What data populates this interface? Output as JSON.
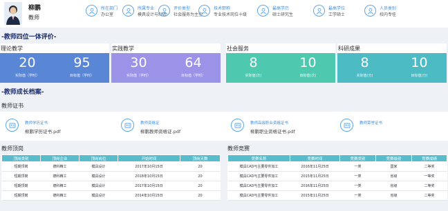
{
  "profile": {
    "name": "柳鹏",
    "role": "教师",
    "fields": [
      {
        "label": "所在部门",
        "value": "办公室"
      },
      {
        "label": "所属专业",
        "value": "模具设计与制造"
      },
      {
        "label": "评价类型",
        "value": "社会服务为主型"
      },
      {
        "label": "技术职称",
        "value": "专业技术岗位十级"
      },
      {
        "label": "最高学历",
        "value": "硕士研究生"
      },
      {
        "label": "最高学位",
        "value": "工学硕士"
      },
      {
        "label": "人员类别",
        "value": "校内专任"
      }
    ]
  },
  "evaluation": {
    "title": "-教师四位一体评价-",
    "cards": [
      {
        "title": "理论教学",
        "color": "#5a86d6",
        "actual": "20",
        "actual_label": "实际值（学时）",
        "target": "95",
        "target_label": "目标值（学时）"
      },
      {
        "title": "实践教学",
        "color": "#9b93e8",
        "actual": "30",
        "actual_label": "实际值（学时）",
        "target": "64",
        "target_label": "目标值（学时）"
      },
      {
        "title": "社会服务",
        "color": "#4ec9b0",
        "actual": "8",
        "actual_label": "实际值(次)",
        "target": "10",
        "target_label": "目标值(次)"
      },
      {
        "title": "科研成果",
        "color": "#4dbbc4",
        "actual": "8",
        "actual_label": "实际值(分)",
        "target": "10",
        "target_label": "目标值(分)"
      }
    ]
  },
  "growth": {
    "title": "-教师成长档案-",
    "certificates_title": "教师证书",
    "certificates": [
      {
        "label": "教师学历证书",
        "file": "柳鹏学历证书.pdf"
      },
      {
        "label": "教师资格证",
        "file": "柳鹏教师资格证.pdf"
      },
      {
        "label": "教师高级职业资格证书",
        "file": "柳鹏职业资格证书.pdf"
      },
      {
        "label": "教师荣誉证书",
        "file": ""
      }
    ]
  },
  "posts": {
    "title": "教师顶岗",
    "columns": [
      "顶岗类别",
      "顶岗企业",
      "顶岗岗位",
      "开始时间",
      "顶岗天数"
    ],
    "rows": [
      [
        "短期顶岗",
        "德科精工",
        "模具设计",
        "2017年10月15日",
        "20"
      ],
      [
        "短期顶岗",
        "德科精工",
        "模具设计",
        "2018年10月15日",
        "20"
      ],
      [
        "短期顶岗",
        "德科精工",
        "模具设计",
        "2017年10月15日",
        "20"
      ],
      [
        "短期顶岗",
        "德科精工",
        "模具设计",
        "2014年10月15日",
        "20"
      ]
    ]
  },
  "contests": {
    "title": "教师竞赛",
    "columns": [
      "竞赛名称",
      "竞赛时间",
      "竞赛类别",
      "竞赛级别",
      "竞赛成绩"
    ],
    "rows": [
      [
        "模具CAD与主要零件加工",
        "2016年11月25日",
        "一类",
        "国家",
        "二等奖"
      ],
      [
        "模具CAD与主要零件加工",
        "2015年11月25日",
        "一类",
        "省级",
        "一等奖"
      ],
      [
        "模具CAD与主要零件加工",
        "2016年11月25日",
        "一类",
        "省级",
        "二等奖"
      ],
      [
        "模具CAD与主要零件加工",
        "2015年11月25日",
        "一类",
        "省级",
        "二等奖"
      ]
    ]
  }
}
